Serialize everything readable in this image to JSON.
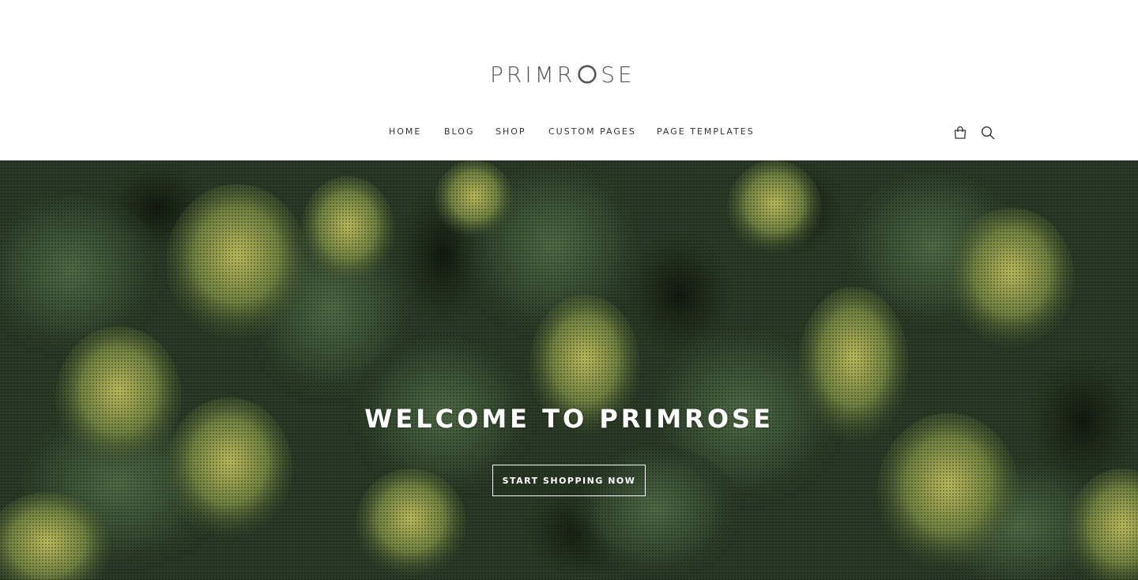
{
  "brand": {
    "logo_part1": "PRIMR",
    "logo_part2": "SE",
    "logo_icon": "rose-outline-icon"
  },
  "nav": {
    "items": [
      {
        "label": "HOME"
      },
      {
        "label": "BLOG"
      },
      {
        "label": "SHOP"
      },
      {
        "label": "CUSTOM PAGES"
      },
      {
        "label": "PAGE TEMPLATES"
      }
    ]
  },
  "header_icons": {
    "cart": "shopping-bag-icon",
    "search": "search-icon"
  },
  "hero": {
    "title": "WELCOME TO PRIMROSE",
    "cta_label": "START SHOPPING NOW",
    "background": "aerial-forest-photo"
  },
  "colors": {
    "header_bg": "#ffffff",
    "nav_text": "#333333",
    "logo_text": "#555555",
    "hero_text": "#ffffff",
    "forest_dark": "#1f2a1a",
    "forest_mid": "#3d5231",
    "forest_light": "#9aa94a"
  }
}
